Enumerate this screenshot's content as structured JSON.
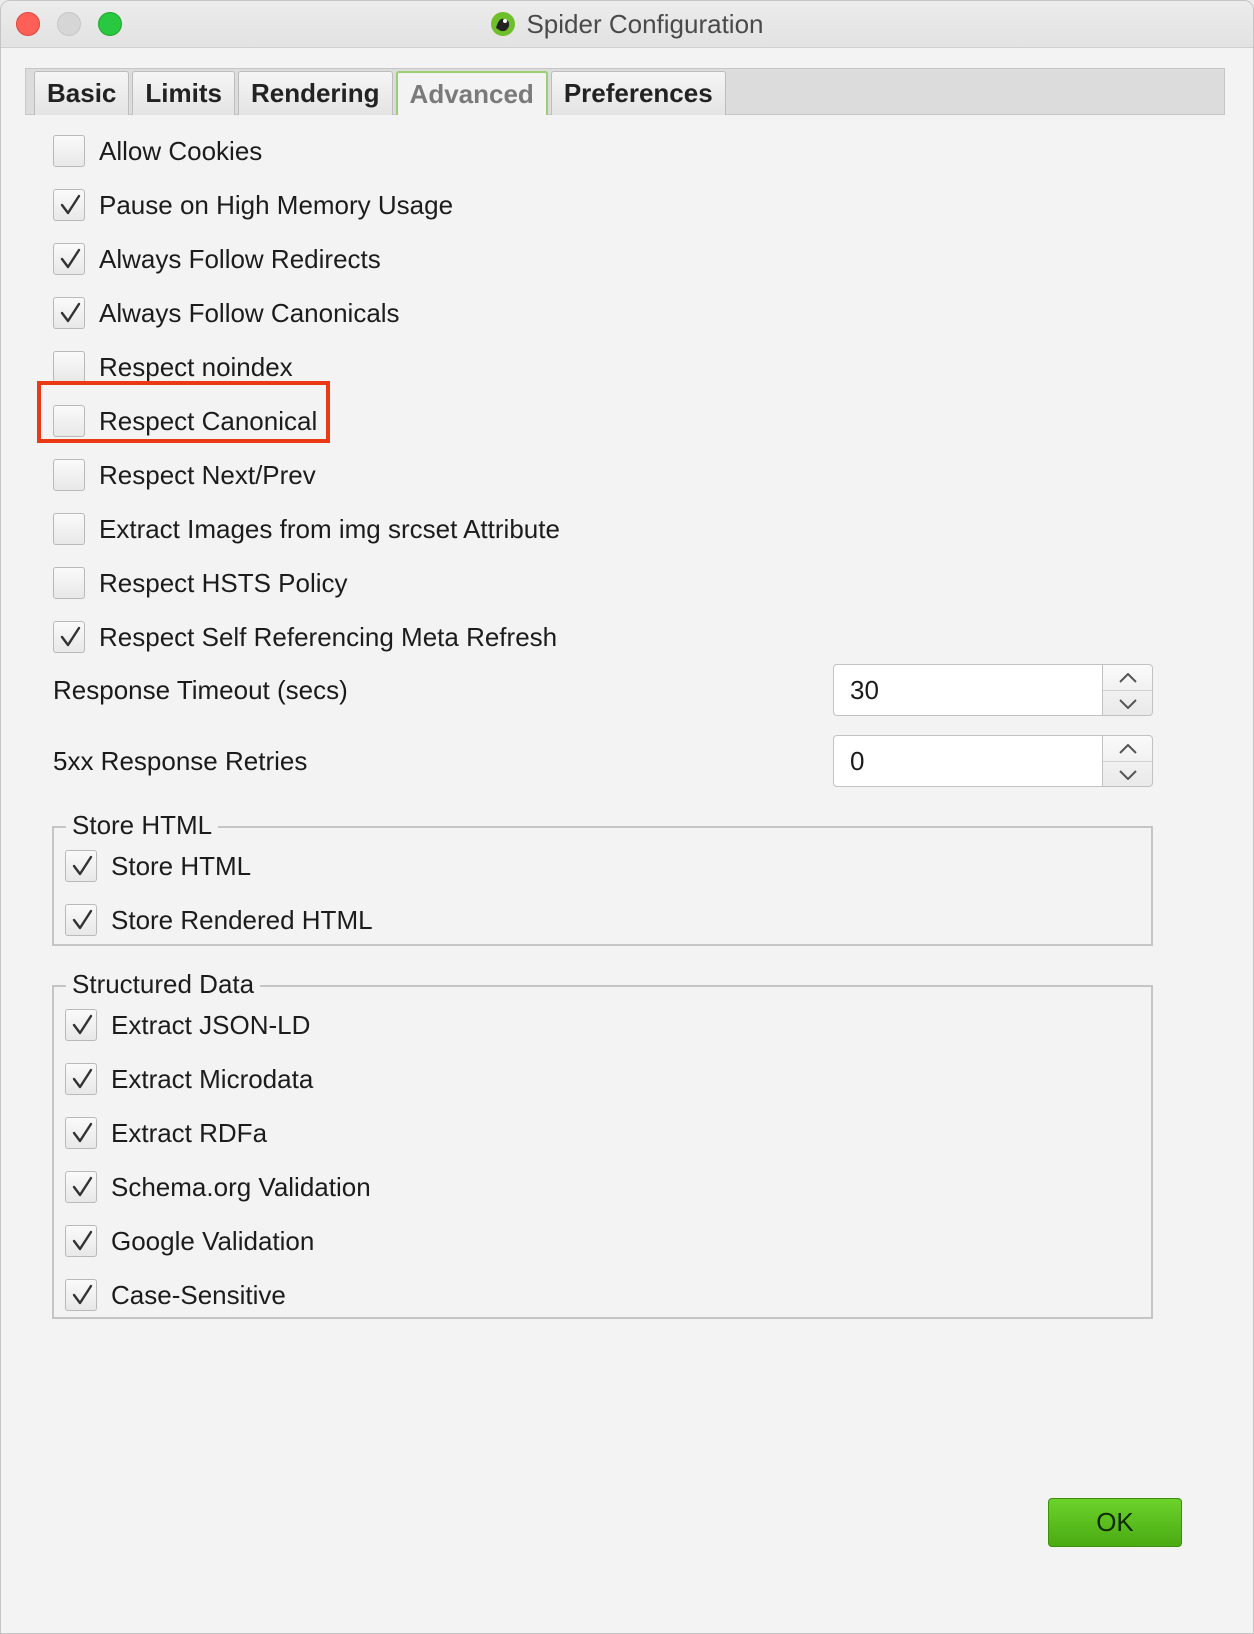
{
  "window": {
    "title": "Spider Configuration",
    "icon": "spider-frog-icon"
  },
  "tabs": [
    {
      "label": "Basic",
      "active": false
    },
    {
      "label": "Limits",
      "active": false
    },
    {
      "label": "Rendering",
      "active": false
    },
    {
      "label": "Advanced",
      "active": true
    },
    {
      "label": "Preferences",
      "active": false
    }
  ],
  "advanced": {
    "options": [
      {
        "label": "Allow Cookies",
        "checked": false
      },
      {
        "label": "Pause on High Memory Usage",
        "checked": true
      },
      {
        "label": "Always Follow Redirects",
        "checked": true
      },
      {
        "label": "Always Follow Canonicals",
        "checked": true
      },
      {
        "label": "Respect noindex",
        "checked": false
      },
      {
        "label": "Respect Canonical",
        "checked": false,
        "highlighted": true
      },
      {
        "label": "Respect Next/Prev",
        "checked": false
      },
      {
        "label": "Extract Images from img srcset Attribute",
        "checked": false
      },
      {
        "label": "Respect HSTS Policy",
        "checked": false
      },
      {
        "label": "Respect Self Referencing Meta Refresh",
        "checked": true
      }
    ],
    "response_timeout": {
      "label": "Response Timeout (secs)",
      "value": "30"
    },
    "response_retries": {
      "label": "5xx Response Retries",
      "value": "0"
    },
    "store_html": {
      "title": "Store HTML",
      "options": [
        {
          "label": "Store HTML",
          "checked": true
        },
        {
          "label": "Store Rendered HTML",
          "checked": true
        }
      ]
    },
    "structured_data": {
      "title": "Structured Data",
      "options": [
        {
          "label": "Extract JSON-LD",
          "checked": true
        },
        {
          "label": "Extract Microdata",
          "checked": true
        },
        {
          "label": "Extract RDFa",
          "checked": true
        },
        {
          "label": "Schema.org Validation",
          "checked": true
        },
        {
          "label": "Google Validation",
          "checked": true
        },
        {
          "label": "Case-Sensitive",
          "checked": true
        }
      ]
    }
  },
  "footer": {
    "ok_label": "OK"
  },
  "colors": {
    "highlight": "#ea3a14",
    "ok_button": "#5bbf1d",
    "active_tab_border": "#9bcf74"
  }
}
